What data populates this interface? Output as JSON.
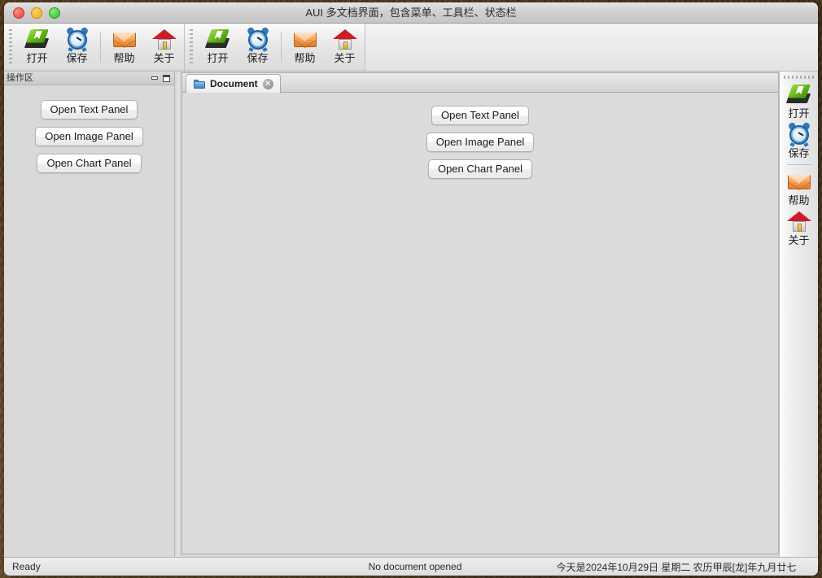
{
  "window": {
    "title": "AUI 多文档界面，包含菜单、工具栏、状态栏",
    "controls": {
      "close": "close",
      "minimize": "minimize",
      "maximize": "maximize"
    }
  },
  "toolbars": {
    "top": [
      {
        "id": "toolbar-1",
        "items": [
          {
            "icon": "open-book-icon",
            "label": "打开"
          },
          {
            "icon": "alarm-clock-icon",
            "label": "保存"
          },
          {
            "separator": true
          },
          {
            "icon": "envelope-icon",
            "label": "帮助"
          },
          {
            "icon": "house-icon",
            "label": "关于"
          }
        ]
      },
      {
        "id": "toolbar-2",
        "items": [
          {
            "icon": "open-book-icon",
            "label": "打开"
          },
          {
            "icon": "alarm-clock-icon",
            "label": "保存"
          },
          {
            "separator": true
          },
          {
            "icon": "envelope-icon",
            "label": "帮助"
          },
          {
            "icon": "house-icon",
            "label": "关于"
          }
        ]
      }
    ],
    "right": {
      "id": "toolbar-right",
      "items": [
        {
          "icon": "open-book-icon",
          "label": "打开"
        },
        {
          "icon": "alarm-clock-icon",
          "label": "保存"
        },
        {
          "separator": true
        },
        {
          "icon": "envelope-icon",
          "label": "帮助"
        },
        {
          "icon": "house-icon",
          "label": "关于"
        }
      ]
    }
  },
  "left_pane": {
    "caption": "操作区",
    "caption_buttons": [
      {
        "name": "minimize-pane-button",
        "glyph": "minimize"
      },
      {
        "name": "maximize-pane-button",
        "glyph": "maximize"
      }
    ],
    "buttons": [
      {
        "label": "Open Text Panel"
      },
      {
        "label": "Open Image Panel"
      },
      {
        "label": "Open Chart Panel"
      }
    ]
  },
  "document_pane": {
    "tabs": [
      {
        "icon": "folder-icon",
        "label": "Document",
        "close": "✕",
        "active": true
      }
    ],
    "buttons": [
      {
        "label": "Open Text Panel"
      },
      {
        "label": "Open Image Panel"
      },
      {
        "label": "Open Chart Panel"
      }
    ]
  },
  "statusbar": {
    "ready": "Ready",
    "document": "No document opened",
    "date": "今天是2024年10月29日 星期二 农历甲辰[龙]年九月廿七"
  },
  "colors": {
    "window_bg": "#e6e6e6",
    "pane_bg": "#d9d9d9",
    "canvas_bg": "#dcdcdc",
    "accent_green": "#5fb015",
    "accent_blue": "#2b6fb5",
    "accent_orange": "#f09a4f",
    "accent_red": "#cf1b26"
  }
}
